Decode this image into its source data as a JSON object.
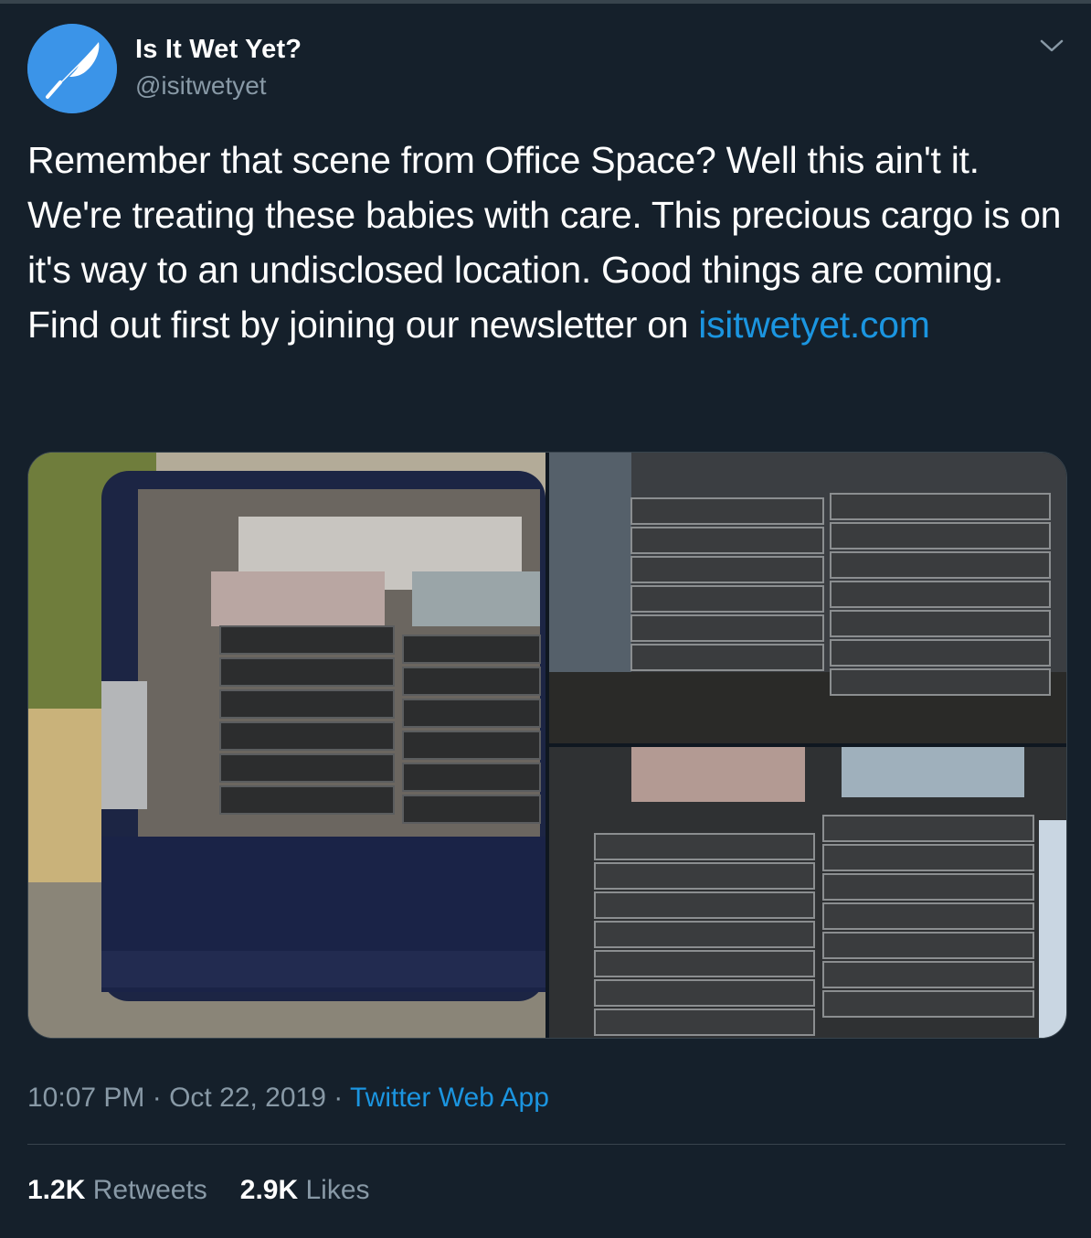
{
  "author": {
    "display_name": "Is It Wet Yet?",
    "handle": "@isitwetyet",
    "avatar_icon": "quill-feather-icon",
    "avatar_color": "#3b94e8"
  },
  "menu_icon": "chevron-down-icon",
  "tweet": {
    "text_before_link": "Remember that scene from Office Space? Well this ain't it. We're treating these babies with care. This precious cargo is on it's way to an undisclosed location. Good things are coming. Find out first by joining our newsletter on ",
    "link_text": "isitwetyet.com"
  },
  "media": {
    "photo_count": 3
  },
  "meta": {
    "time": "10:07 PM",
    "separator": " · ",
    "date": "Oct 22, 2019",
    "source": "Twitter Web App"
  },
  "stats": {
    "retweets_count": "1.2K",
    "retweets_label": "Retweets",
    "likes_count": "2.9K",
    "likes_label": "Likes"
  },
  "colors": {
    "background": "#15202b",
    "link": "#1b95e0",
    "secondary_text": "#8899a6",
    "divider": "#38444d"
  }
}
